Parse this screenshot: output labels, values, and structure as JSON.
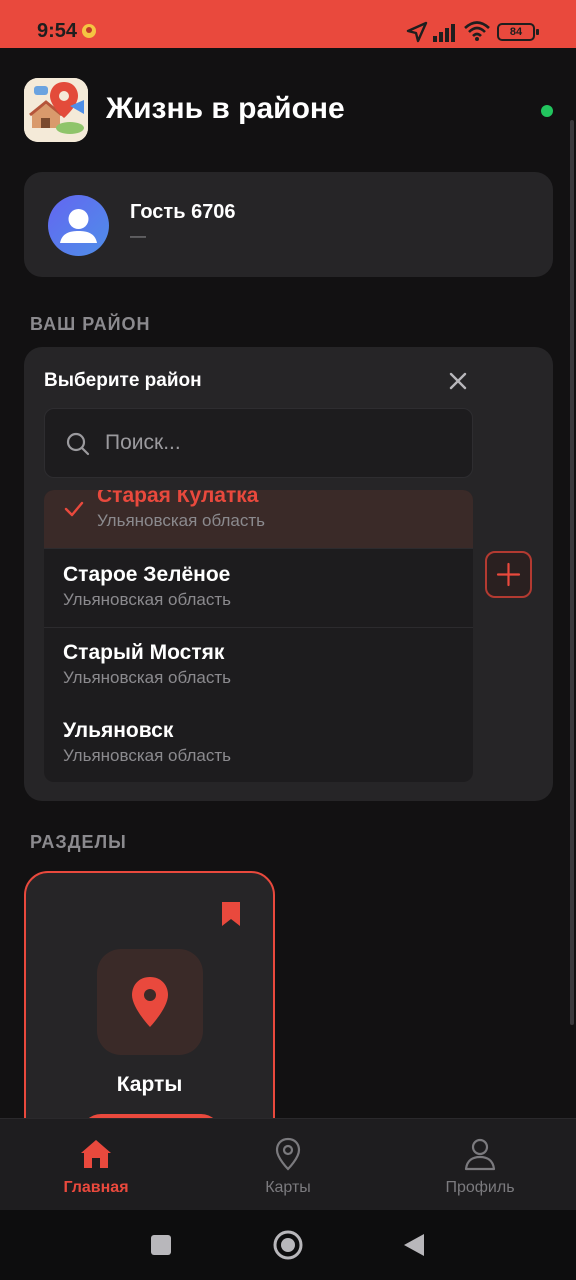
{
  "status_bar": {
    "time": "9:54",
    "battery": "84"
  },
  "header": {
    "title": "Жизнь в районе"
  },
  "user": {
    "name": "Гость 6706",
    "subtitle": "—"
  },
  "district_section": {
    "label": "ВАШ РАЙОН",
    "selector_title": "Выберите район",
    "search_placeholder": "Поиск...",
    "items": [
      {
        "name": "Старая Кулатка",
        "region": "Ульяновская область",
        "selected": true
      },
      {
        "name": "Старое Зелёное",
        "region": "Ульяновская область"
      },
      {
        "name": "Старый Мостяк",
        "region": "Ульяновская область"
      },
      {
        "name": "Ульяновск",
        "region": "Ульяновская область"
      }
    ]
  },
  "sections": {
    "label": "РАЗДЕЛЫ",
    "cards": [
      {
        "title": "Карты"
      }
    ]
  },
  "bottom_nav": {
    "items": [
      {
        "label": "Главная",
        "icon": "home-icon",
        "active": true
      },
      {
        "label": "Карты",
        "icon": "map-pin-icon"
      },
      {
        "label": "Профиль",
        "icon": "profile-icon"
      }
    ]
  },
  "colors": {
    "accent": "#e9493d",
    "background": "#121112",
    "card": "#262527",
    "online": "#22c55e"
  }
}
